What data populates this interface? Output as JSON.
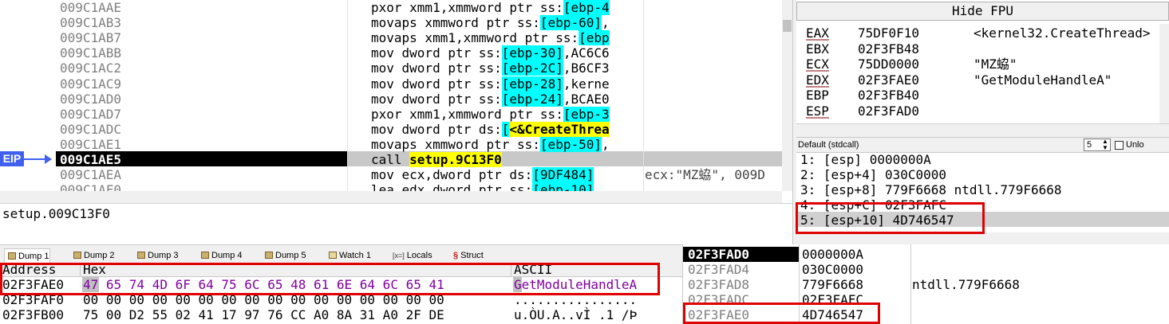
{
  "disasm": {
    "rows": [
      {
        "addr": "009C1AAE",
        "code": "pxor xmm1,xmmword ptr ss:",
        "b1": "[ebp-4",
        "tail": "",
        "comment": ""
      },
      {
        "addr": "009C1AB3",
        "code": "movaps xmmword ptr ss:",
        "b1": "[ebp-60]",
        "tail": ",",
        "comment": ""
      },
      {
        "addr": "009C1AB7",
        "code": "movaps xmm1,xmmword ptr ss:",
        "b1": "[ebp",
        "tail": "",
        "comment": ""
      },
      {
        "addr": "009C1ABB",
        "code": "mov dword ptr ss:",
        "b1": "[ebp-30]",
        "tail": ",AC6C6",
        "comment": ""
      },
      {
        "addr": "009C1AC2",
        "code": "mov dword ptr ss:",
        "b1": "[ebp-2C]",
        "tail": ",B6CF3",
        "comment": ""
      },
      {
        "addr": "009C1AC9",
        "code": "mov dword ptr ss:",
        "b1": "[ebp-28]",
        "tail": ",kerne",
        "comment": ""
      },
      {
        "addr": "009C1AD0",
        "code": "mov dword ptr ss:",
        "b1": "[ebp-24]",
        "tail": ",BCAE0",
        "comment": ""
      },
      {
        "addr": "009C1AD7",
        "code": "pxor xmm1,xmmword ptr ss:",
        "b1": "[ebp-3",
        "tail": "",
        "comment": ""
      },
      {
        "addr": "009C1ADC",
        "code": "mov dword ptr ds:",
        "b1": "[",
        "tail": "",
        "comment": ""
      },
      {
        "addr": "009C1AE1",
        "code": "movaps xmmword ptr ss:",
        "b1": "[ebp-50]",
        "tail": ",",
        "comment": ""
      },
      {
        "addr": "009C1AE5",
        "code": "call ",
        "b1": "",
        "tail": "",
        "comment": ""
      },
      {
        "addr": "009C1AEA",
        "code": "mov ecx,dword ptr ds:",
        "b1": "[9DF484]",
        "tail": "",
        "comment": "ecx:\"MZ蛠\", 009D"
      },
      {
        "addr": "009C1AF0",
        "code": "lea edx,dword ptr ss:",
        "b1": "[ebp-10]",
        "tail": "",
        "comment": ""
      }
    ],
    "create_thread_label": "<&CreateThrea",
    "call_target": "setup.9C13F0",
    "eip_label": "EIP",
    "info_line": "setup.009C13F0"
  },
  "registers": {
    "hide_fpu": "Hide FPU",
    "rows": [
      {
        "name": "EAX",
        "value": "75DF0F10",
        "comment": "<kernel32.CreateThread>"
      },
      {
        "name": "EBX",
        "value": "02F3FB48",
        "comment": ""
      },
      {
        "name": "ECX",
        "value": "75DD0000",
        "comment": "\"MZ蛠\""
      },
      {
        "name": "EDX",
        "value": "02F3FAE0",
        "comment": "\"GetModuleHandleA\""
      },
      {
        "name": "EBP",
        "value": "02F3FB40",
        "comment": ""
      },
      {
        "name": "ESP",
        "value": "02F3FAD0",
        "comment": ""
      }
    ]
  },
  "callconv": {
    "label": "Default (stdcall)",
    "count": "5",
    "unlock": "Unlo"
  },
  "args": [
    "1: [esp] 0000000A",
    "2: [esp+4] 030C0000",
    "3: [esp+8] 779F6668 ntdll.779F6668",
    "4: [esp+C] 02F3FAFC",
    "5: [esp+10] 4D746547"
  ],
  "tabs": [
    "Dump 1",
    "Dump 2",
    "Dump 3",
    "Dump 4",
    "Dump 5",
    "Watch 1",
    "Locals",
    "Struct"
  ],
  "locals_prefix": "[x=]",
  "dump": {
    "headers": {
      "address": "Address",
      "hex": "Hex",
      "ascii": "ASCII"
    },
    "rows": [
      {
        "addr": "02F3FAE0",
        "hex": "47 65 74 4D 6F 64 75 6C 65 48 61 6E 64 6C 65 41",
        "ascii": "GetModuleHandleA"
      },
      {
        "addr": "02F3FAF0",
        "hex": "00 00 00 00 00 00 00 00 00 00 00 00 00 00 00 00",
        "ascii": "................"
      },
      {
        "addr": "02F3FB00",
        "hex": "75 00 D2 55 02 41 17 97 76 CC A0 8A 31 A0 2F DE",
        "ascii": "u.ÒU.A..vÌ .1 /Þ"
      }
    ]
  },
  "stack": {
    "rows": [
      {
        "addr": "02F3FAD0",
        "value": "0000000A",
        "comment": ""
      },
      {
        "addr": "02F3FAD4",
        "value": "030C0000",
        "comment": ""
      },
      {
        "addr": "02F3FAD8",
        "value": "779F6668",
        "comment": "ntdll.779F6668"
      },
      {
        "addr": "02F3FADC",
        "value": "02F3FAFC",
        "comment": ""
      },
      {
        "addr": "02F3FAE0",
        "value": "4D746547",
        "comment": ""
      }
    ]
  }
}
